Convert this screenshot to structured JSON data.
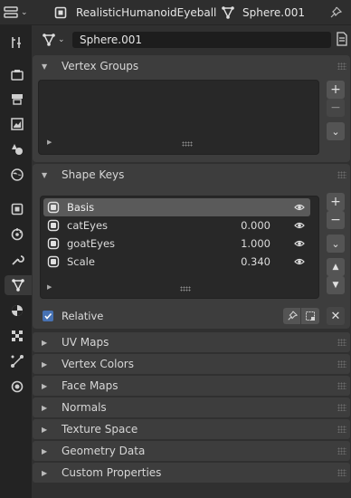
{
  "header": {
    "object_name": "RealisticHumanoidEyeball",
    "mesh_name": "Sphere.001"
  },
  "data_block": {
    "name": "Sphere.001"
  },
  "vertex_groups": {
    "title": "Vertex Groups"
  },
  "shape_keys": {
    "title": "Shape Keys",
    "keys": [
      {
        "name": "Basis",
        "value": "",
        "selected": true
      },
      {
        "name": "catEyes",
        "value": "0.000",
        "selected": false
      },
      {
        "name": "goatEyes",
        "value": "1.000",
        "selected": false
      },
      {
        "name": "Scale",
        "value": "0.340",
        "selected": false
      }
    ],
    "relative_label": "Relative",
    "relative_checked": true
  },
  "collapsed_panels": [
    "UV Maps",
    "Vertex Colors",
    "Face Maps",
    "Normals",
    "Texture Space",
    "Geometry Data",
    "Custom Properties"
  ],
  "tabs": [
    "tool-icon",
    "render-icon",
    "output-icon",
    "view-layer-icon",
    "scene-icon",
    "world-icon",
    "object-icon",
    "modifier-icon",
    "particles-icon",
    "physics-icon",
    "object-data-icon",
    "material-icon",
    "texture-icon",
    "constraints-icon",
    "data-icon"
  ],
  "colors": {
    "accent": "#4772b3",
    "panel": "#3d3d3d",
    "background": "#303030"
  }
}
